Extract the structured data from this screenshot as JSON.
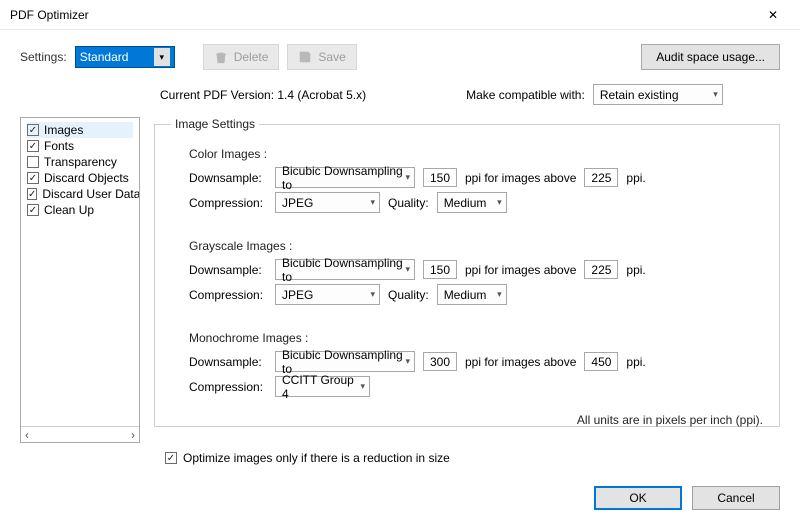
{
  "title": "PDF Optimizer",
  "toolbar": {
    "settings_label": "Settings:",
    "settings_value": "Standard",
    "delete": "Delete",
    "save": "Save",
    "audit": "Audit space usage..."
  },
  "info": {
    "version": "Current PDF Version: 1.4 (Acrobat 5.x)",
    "compat_label": "Make compatible with:",
    "compat_value": "Retain existing"
  },
  "sidebar": {
    "items": [
      {
        "label": "Images",
        "checked": true,
        "sel": true
      },
      {
        "label": "Fonts",
        "checked": true
      },
      {
        "label": "Transparency",
        "checked": false
      },
      {
        "label": "Discard Objects",
        "checked": true
      },
      {
        "label": "Discard User Data",
        "checked": true
      },
      {
        "label": "Clean Up",
        "checked": true
      }
    ]
  },
  "panel": {
    "legend": "Image Settings",
    "sections": {
      "color": {
        "title": "Color Images :",
        "downsample_label": "Downsample:",
        "downsample_val": "Bicubic Downsampling to",
        "ppi1": "150",
        "above_label": "ppi for images above",
        "ppi2": "225",
        "ppi_suffix": "ppi.",
        "compression_label": "Compression:",
        "compression_val": "JPEG",
        "quality_label": "Quality:",
        "quality_val": "Medium"
      },
      "gray": {
        "title": "Grayscale Images :",
        "downsample_val": "Bicubic Downsampling to",
        "ppi1": "150",
        "ppi2": "225",
        "compression_val": "JPEG",
        "quality_val": "Medium"
      },
      "mono": {
        "title": "Monochrome Images :",
        "downsample_val": "Bicubic Downsampling to",
        "ppi1": "300",
        "ppi2": "450",
        "compression_val": "CCITT Group 4"
      }
    },
    "footnote": "All units are in pixels per inch (ppi)."
  },
  "optimize_check": "Optimize images only if there is a reduction in size",
  "buttons": {
    "ok": "OK",
    "cancel": "Cancel"
  },
  "glyph": {
    "check": "✓",
    "down": "▾",
    "left": "‹",
    "right": "›",
    "close": "✕"
  }
}
